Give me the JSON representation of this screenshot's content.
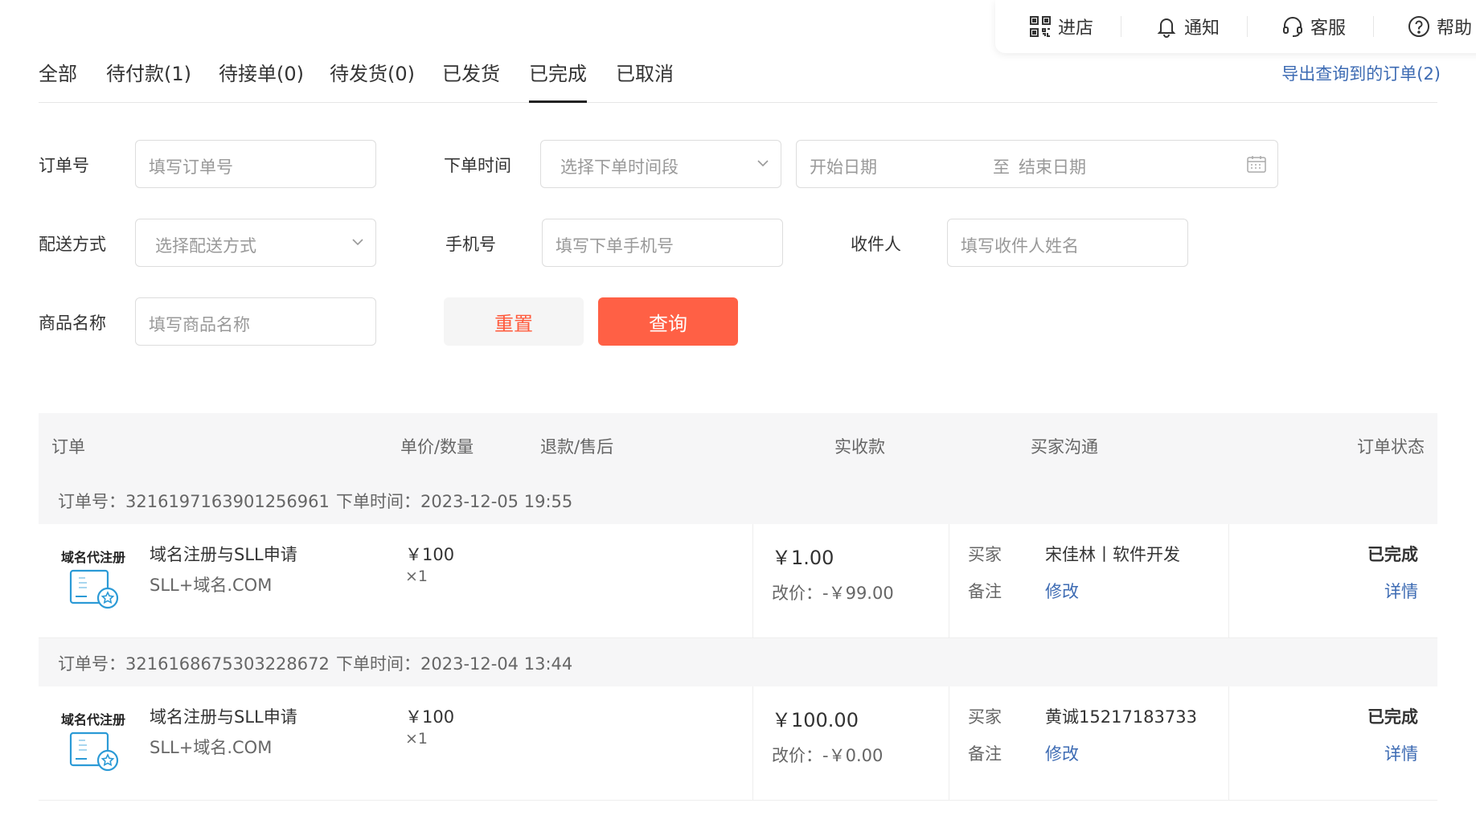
{
  "topbar": {
    "items": [
      {
        "label": "进店",
        "icon": "qrcode-icon"
      },
      {
        "label": "通知",
        "icon": "bell-icon"
      },
      {
        "label": "客服",
        "icon": "headset-icon"
      },
      {
        "label": "帮助",
        "icon": "help-circle-icon"
      }
    ]
  },
  "tabs": [
    "全部",
    "待付款(1)",
    "待接单(0)",
    "待发货(0)",
    "已发货",
    "已完成",
    "已取消"
  ],
  "active_tab": "已完成",
  "export_label": "导出查询到的订单(2)",
  "filters": {
    "order_no": {
      "label": "订单号",
      "placeholder": "填写订单号"
    },
    "order_time": {
      "label": "下单时间",
      "placeholder": "选择下单时间段"
    },
    "start_date": "开始日期",
    "date_sep": "至",
    "end_date": "结束日期",
    "delivery": {
      "label": "配送方式",
      "placeholder": "选择配送方式"
    },
    "phone": {
      "label": "手机号",
      "placeholder": "填写下单手机号"
    },
    "receiver": {
      "label": "收件人",
      "placeholder": "填写收件人姓名"
    },
    "product": {
      "label": "商品名称",
      "placeholder": "填写商品名称"
    },
    "reset_label": "重置",
    "query_label": "查询"
  },
  "table": {
    "headers": {
      "order": "订单",
      "price_qty": "单价/数量",
      "refund": "退款/售后",
      "paid": "实收款",
      "buyer": "买家沟通",
      "status": "订单状态"
    }
  },
  "orders": [
    {
      "order_no": "订单号：3216197163901256961",
      "order_time": "下单时间：2023-12-05 19:55",
      "logo_text": "域名代注册",
      "product_name": "域名注册与SLL申请",
      "product_spec": "SLL+域名.COM",
      "unit_price": "￥100",
      "qty": "×1",
      "paid": "￥1.00",
      "price_change": "改价：-￥99.00",
      "buyer_label": "买家",
      "buyer_name": "宋佳林丨软件开发",
      "remark_label": "备注",
      "remark_action": "修改",
      "status": "已完成",
      "detail": "详情"
    },
    {
      "order_no": "订单号：3216168675303228672",
      "order_time": "下单时间：2023-12-04 13:44",
      "logo_text": "域名代注册",
      "product_name": "域名注册与SLL申请",
      "product_spec": "SLL+域名.COM",
      "unit_price": "￥100",
      "qty": "×1",
      "paid": "￥100.00",
      "price_change": "改价：-￥0.00",
      "buyer_label": "买家",
      "buyer_name": "黄诚15217183733",
      "remark_label": "备注",
      "remark_action": "修改",
      "status": "已完成",
      "detail": "详情"
    }
  ],
  "colors": {
    "accent": "#ff6045",
    "link": "#3d6bb3",
    "logo_blue": "#2b9ad6"
  }
}
